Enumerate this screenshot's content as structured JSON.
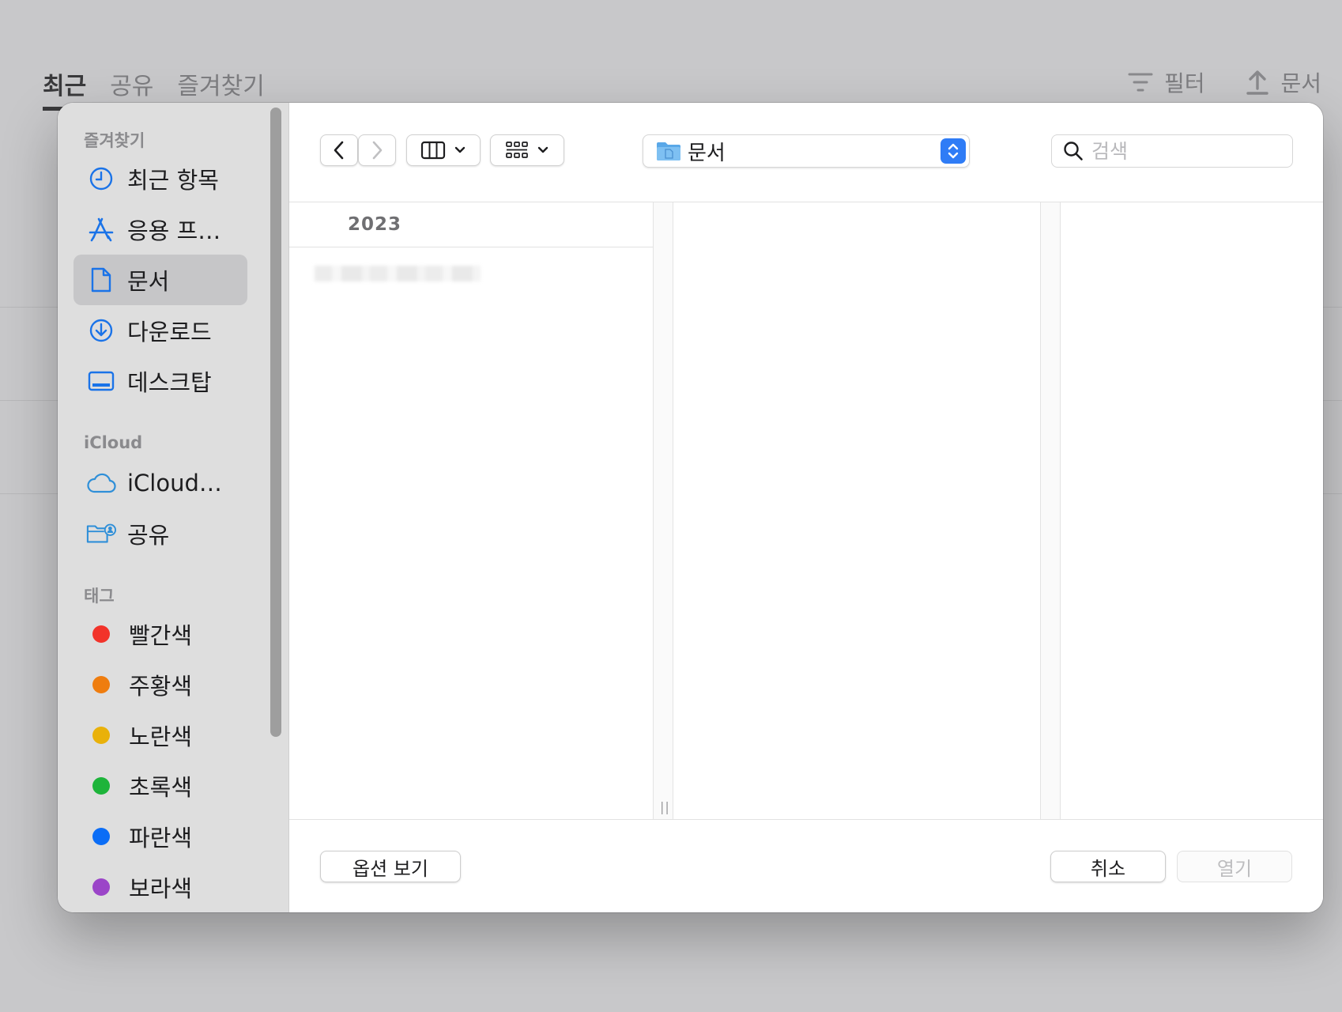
{
  "background": {
    "tabs": [
      {
        "label": "최근",
        "active": true
      },
      {
        "label": "공유",
        "active": false
      },
      {
        "label": "즐겨찾기",
        "active": false
      }
    ],
    "filter_label": "필터",
    "upload_label": "문서"
  },
  "sidebar": {
    "favorites_title": "즐겨찾기",
    "favorites": [
      {
        "label": "최근 항목",
        "icon": "clock-icon"
      },
      {
        "label": "응용 프…",
        "icon": "app-store-icon"
      },
      {
        "label": "문서",
        "icon": "document-icon",
        "selected": true
      },
      {
        "label": "다운로드",
        "icon": "download-icon"
      },
      {
        "label": "데스크탑",
        "icon": "desktop-icon"
      }
    ],
    "icloud_title": "iCloud",
    "icloud": [
      {
        "label": "iCloud…",
        "icon": "cloud-icon"
      },
      {
        "label": "공유",
        "icon": "shared-folder-icon"
      }
    ],
    "tags_title": "태그",
    "tags": [
      {
        "label": "빨간색",
        "color": "#f2332a"
      },
      {
        "label": "주황색",
        "color": "#ef7d0f"
      },
      {
        "label": "노란색",
        "color": "#e9b10a"
      },
      {
        "label": "초록색",
        "color": "#1db43a"
      },
      {
        "label": "파란색",
        "color": "#0b6df6"
      },
      {
        "label": "보라색",
        "color": "#9b45c8"
      }
    ]
  },
  "toolbar": {
    "path_label": "문서",
    "search_placeholder": "검색"
  },
  "browser": {
    "column_header": "2023"
  },
  "footer": {
    "options_label": "옵션 보기",
    "cancel_label": "취소",
    "open_label": "열기"
  }
}
